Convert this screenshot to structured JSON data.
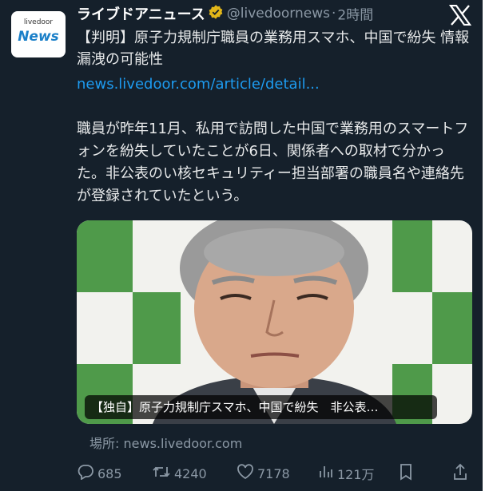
{
  "account": {
    "display_name": "ライブドアニュース",
    "handle": "@livedoornews",
    "separator": "·",
    "time": "2時間",
    "avatar_small": "livedoor",
    "avatar_big": "News"
  },
  "tweet": {
    "title": "【判明】原子力規制庁職員の業務用スマホ、中国で紛失 情報漏洩の可能性",
    "link": "news.livedoor.com/article/detail...",
    "body": "職員が昨年11月、私用で訪問した中国で業務用のスマートフォンを紛失していたことが6日、関係者への取材で分かった。非公表のい核セキュリティー担当部署の職員名や連絡先が登録されていたという。"
  },
  "card": {
    "caption": "【独自】原子力規制庁スマホ、中国で紛失　非公表…",
    "source_label": "場所:",
    "source_domain": "news.livedoor.com"
  },
  "actions": {
    "replies": "685",
    "retweets": "4240",
    "likes": "7178",
    "views": "121万"
  },
  "colors": {
    "background": "#15202b",
    "text": "#e7e9ea",
    "muted": "#8b98a5",
    "link": "#1d9bf0",
    "verified": "#e2b719"
  }
}
